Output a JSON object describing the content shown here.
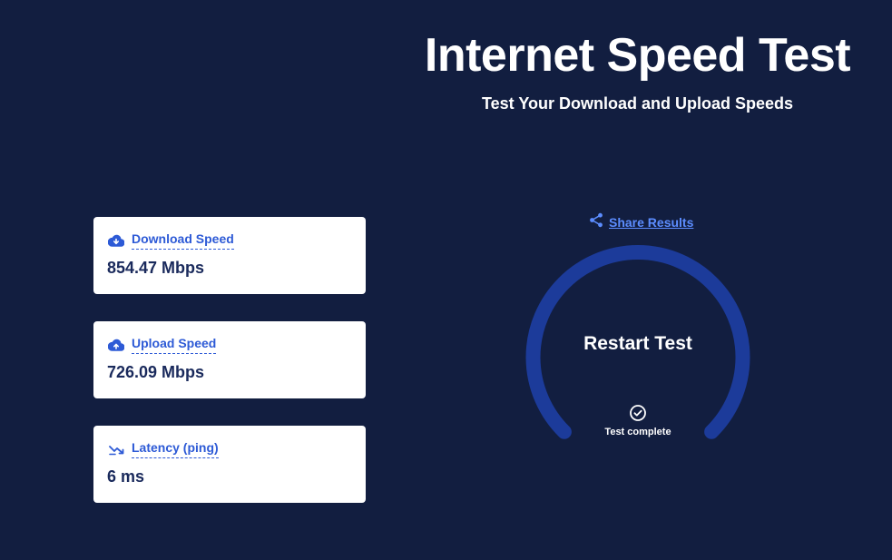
{
  "header": {
    "title": "Internet Speed Test",
    "subtitle": "Test Your Download and Upload Speeds"
  },
  "results": {
    "download": {
      "label": "Download Speed",
      "value": "854.47 Mbps",
      "icon": "cloud-download-icon"
    },
    "upload": {
      "label": "Upload Speed",
      "value": "726.09 Mbps",
      "icon": "cloud-upload-icon"
    },
    "latency": {
      "label": "Latency (ping)",
      "value": "6 ms",
      "icon": "latency-icon"
    }
  },
  "share": {
    "label": "Share Results",
    "icon": "share-icon"
  },
  "gauge": {
    "button_label": "Restart Test",
    "status_text": "Test complete",
    "status_icon": "check-circle-icon"
  },
  "colors": {
    "background": "#121e40",
    "card": "#ffffff",
    "accent": "#2d5ad6",
    "link": "#5c8dff",
    "gauge_arc": "#1c3b9a",
    "value_text": "#1a2a5c"
  }
}
